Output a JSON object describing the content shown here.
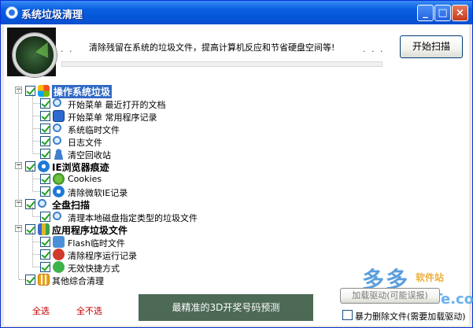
{
  "window": {
    "title": "系统垃圾清理",
    "controls": [
      "minimize",
      "maximize",
      "close"
    ]
  },
  "header": {
    "dots_left": ". .",
    "description": "清除残留在系统的垃圾文件，提高计算机反应和节省硬盘空间等!",
    "dots_right": ". . .",
    "progress": 0,
    "scan_button": "开始扫描"
  },
  "tree": {
    "groups": [
      {
        "label": "操作系统垃圾",
        "icon": "windows-logo-icon",
        "selected": true,
        "items": [
          {
            "label": "开始菜单 最近打开的文档",
            "icon": "magnifier-icon"
          },
          {
            "label": "开始菜单 常用程序记录",
            "icon": "monitor-icon"
          },
          {
            "label": "系统临时文件",
            "icon": "magnifier-icon"
          },
          {
            "label": "日志文件",
            "icon": "magnifier-icon"
          },
          {
            "label": "清空回收站",
            "icon": "user-icon"
          }
        ]
      },
      {
        "label": "IE浏览器痕迹",
        "icon": "ie-logo-icon",
        "items": [
          {
            "label": "Cookies",
            "icon": "globe-icon"
          },
          {
            "label": "清除微软IE记录",
            "icon": "ie-logo-icon"
          }
        ]
      },
      {
        "label": "全盘扫描",
        "icon": "magnifier-icon",
        "items": [
          {
            "label": "清理本地磁盘指定类型的垃圾文件",
            "icon": "magnifier-icon"
          }
        ]
      },
      {
        "label": "应用程序垃圾文件",
        "icon": "books-icon",
        "items": [
          {
            "label": "Flash临时文件",
            "icon": "flash-icon"
          },
          {
            "label": "清除程序运行记录",
            "icon": "stop-icon"
          },
          {
            "label": "无效快捷方式",
            "icon": "shortcut-icon"
          }
        ]
      }
    ],
    "extra_item": {
      "label": "其他综合清理",
      "icon": "grid-icon"
    }
  },
  "footer": {
    "select_all": "全选",
    "select_none": "全不选",
    "banner": "最精准的3D开奖号码预测",
    "load_driver_button": "加载驱动(可能误报)",
    "force_delete_label": "暴力删除文件(需要加载驱动)"
  },
  "watermark": {
    "brand": "多多",
    "sub": "软件站",
    "url": "DuoTe.com"
  },
  "colors": {
    "titlebar": "#0456d8",
    "link_red": "#c00000",
    "selection": "#316ac5",
    "banner_bg": "#4d6a57"
  }
}
